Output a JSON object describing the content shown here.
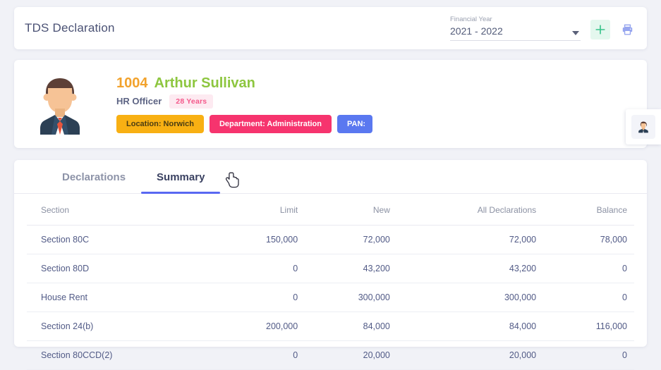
{
  "header": {
    "title": "TDS Declaration",
    "financial_year_label": "Financial Year",
    "financial_year_value": "2021 - 2022",
    "add_label": "+",
    "add_icon": "plus-icon",
    "print_icon": "printer-icon",
    "caret_icon": "chevron-down-icon"
  },
  "profile": {
    "avatar_icon": "user-avatar-illustration",
    "employee_id": "1004",
    "employee_name": "Arthur Sullivan",
    "role": "HR Officer",
    "years_badge": "28 Years",
    "tags": [
      {
        "label": "Location: Norwich",
        "color": "#f8b013"
      },
      {
        "label": "Department: Administration",
        "color": "#f6346e"
      },
      {
        "label": "PAN:",
        "color": "#5a78f0"
      }
    ]
  },
  "side_widget": {
    "icon": "person-icon"
  },
  "tabs": [
    {
      "label": "Declarations",
      "active": false
    },
    {
      "label": "Summary",
      "active": true
    }
  ],
  "table": {
    "columns": [
      "Section",
      "Limit",
      "New",
      "All Declarations",
      "Balance"
    ],
    "rows": [
      {
        "section": "Section 80C",
        "limit": "150,000",
        "new": "72,000",
        "all_declarations": "72,000",
        "balance": "78,000"
      },
      {
        "section": "Section 80D",
        "limit": "0",
        "new": "43,200",
        "all_declarations": "43,200",
        "balance": "0"
      },
      {
        "section": "House Rent",
        "limit": "0",
        "new": "300,000",
        "all_declarations": "300,000",
        "balance": "0"
      },
      {
        "section": "Section 24(b)",
        "limit": "200,000",
        "new": "84,000",
        "all_declarations": "84,000",
        "balance": "116,000"
      },
      {
        "section": "Section 80CCD(2)",
        "limit": "0",
        "new": "20,000",
        "all_declarations": "20,000",
        "balance": "0"
      }
    ]
  },
  "cursor": {
    "icon": "pointing-hand-cursor"
  }
}
